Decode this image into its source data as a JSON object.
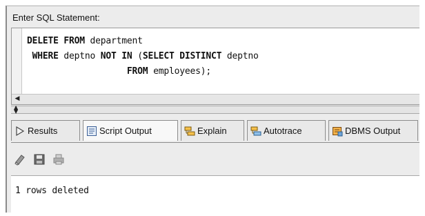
{
  "sql_label": "Enter SQL Statement:",
  "sql": {
    "line1_kw": "DELETE FROM",
    "line1_rest": " department",
    "line2_kw1": "WHERE",
    "line2_mid": " deptno ",
    "line2_kw2": "NOT IN",
    "line2_paren": " (",
    "line2_kw3": "SELECT DISTINCT",
    "line2_rest": " deptno",
    "line3_kw": "FROM",
    "line3_rest": " employees);"
  },
  "tabs": [
    {
      "label": "Results",
      "icon": "play-triangle-icon"
    },
    {
      "label": "Script Output",
      "icon": "script-icon"
    },
    {
      "label": "Explain",
      "icon": "explain-plan-icon"
    },
    {
      "label": "Autotrace",
      "icon": "autotrace-icon"
    },
    {
      "label": "DBMS Output",
      "icon": "dbms-output-icon"
    }
  ],
  "active_tab": "Script Output",
  "toolbar": [
    {
      "icon": "eraser-icon",
      "tooltip": ""
    },
    {
      "icon": "save-icon",
      "tooltip": ""
    },
    {
      "icon": "print-icon",
      "tooltip": ""
    }
  ],
  "output": {
    "text": "1 rows deleted"
  },
  "colors": {
    "panel_bg": "#ececec",
    "editor_bg": "#ffffff",
    "border": "#8c8c8c"
  }
}
